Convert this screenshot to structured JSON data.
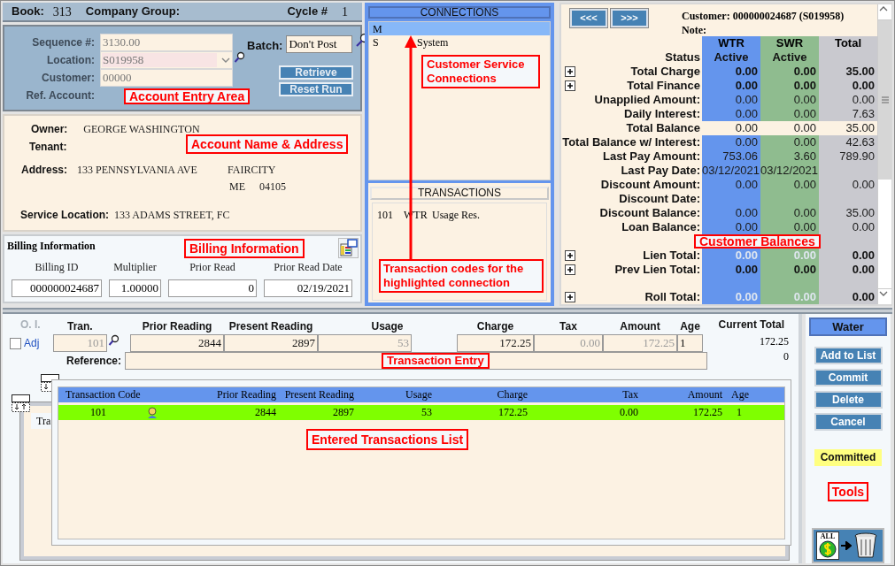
{
  "header": {
    "book_label": "Book:",
    "book": "313",
    "company_group_label": "Company Group:",
    "cycle_label": "Cycle #",
    "cycle": "1"
  },
  "account_entry": {
    "fields": [
      {
        "label": "Sequence #:",
        "value": "3130.00",
        "kind": "text"
      },
      {
        "label": "Location:",
        "value": "S019958",
        "kind": "dropdown"
      },
      {
        "label": "Customer:",
        "value": "00000",
        "kind": "text"
      },
      {
        "label": "Ref. Account:",
        "kind": "none"
      }
    ],
    "batch_label": "Batch:",
    "batch": "Don't Post",
    "buttons": [
      "Retrieve",
      "Reset Run"
    ],
    "annotation": "Account Entry Area"
  },
  "name_address": {
    "owner_label": "Owner:",
    "owner": "GEORGE WASHINGTON",
    "tenant_label": "Tenant:",
    "address_label": "Address:",
    "street": "133 PENNSYLVANIA AVE",
    "city": "FAIRCITY",
    "state": "ME",
    "zip": "04105",
    "service_location_label": "Service Location:",
    "service_location": "133 ADAMS STREET, FC",
    "annotation": "Account Name & Address"
  },
  "billing": {
    "title": "Billing Information",
    "annotation": "Billing Information",
    "fields": [
      {
        "label": "Billing ID",
        "value": "000000024687"
      },
      {
        "label": "Multiplier",
        "value": "1.00000"
      },
      {
        "label": "Prior Read",
        "value": "0"
      },
      {
        "label": "Prior Read Date",
        "value": "02/19/2021"
      }
    ]
  },
  "connections": {
    "title": "CONNECTIONS",
    "items": [
      {
        "code": "M",
        "selected": true
      },
      {
        "code": "S",
        "name": "System",
        "selected": false
      }
    ],
    "annotation": "Customer Service Connections"
  },
  "transactions": {
    "title": "TRANSACTIONS",
    "items": [
      {
        "code": "101",
        "service": "WTR",
        "description": "Usage Res."
      }
    ],
    "annotation": "Transaction codes for the highlighted connection"
  },
  "balances": {
    "nav": [
      "<<<",
      ">>>"
    ],
    "customer": "Customer: 000000024687 (S019958)",
    "note": "Note:",
    "columns": [
      "WTR",
      "SWR",
      "Total"
    ],
    "annotation": "Customer Balances",
    "rows": [
      {
        "label": "Status",
        "wtr": "Active",
        "swr": "Active",
        "kind": "status",
        "expandable": false
      },
      {
        "label": "Total Charge",
        "wtr": "0.00",
        "swr": "0.00",
        "total": "35.00",
        "kind": "bold",
        "expandable": true
      },
      {
        "label": "Total Finance",
        "wtr": "0.00",
        "swr": "0.00",
        "total": "0.00",
        "kind": "bold",
        "expandable": true
      },
      {
        "label": "Unapplied Amount:",
        "wtr": "0.00",
        "swr": "0.00",
        "total": "0.00",
        "kind": "normal",
        "expandable": false
      },
      {
        "label": "Daily Interest:",
        "wtr": "0.00",
        "swr": "0.00",
        "total": "7.63",
        "kind": "normal",
        "expandable": false
      },
      {
        "label": "Total Balance",
        "wtr": "0.00",
        "swr": "0.00",
        "total": "35.00",
        "kind": "highlight",
        "expandable": false
      },
      {
        "label": "Total Balance w/ Interest:",
        "wtr": "0.00",
        "swr": "0.00",
        "total": "42.63",
        "kind": "normal",
        "expandable": false
      },
      {
        "label": "Last Pay Amount:",
        "wtr": "753.06",
        "swr": "3.60",
        "total": "789.90",
        "kind": "normal",
        "expandable": false
      },
      {
        "label": "Last Pay Date:",
        "wtr": "03/12/2021",
        "swr": "03/12/2021",
        "kind": "normal",
        "expandable": false
      },
      {
        "label": "Discount Amount:",
        "wtr": "0.00",
        "swr": "0.00",
        "total": "0.00",
        "kind": "normal",
        "expandable": false
      },
      {
        "label": "Discount Date:",
        "kind": "normal",
        "expandable": false
      },
      {
        "label": "Discount Balance:",
        "wtr": "0.00",
        "swr": "0.00",
        "total": "35.00",
        "kind": "normal",
        "expandable": false
      },
      {
        "label": "Loan Balance:",
        "wtr": "0.00",
        "swr": "0.00",
        "total": "0.00",
        "kind": "normal",
        "expandable": false
      },
      {
        "label": "Lien Total:",
        "wtr": "0.00",
        "swr": "0.00",
        "total": "0.00",
        "kind": "dimmed",
        "expandable": true,
        "gap_before": true
      },
      {
        "label": "Prev Lien Total:",
        "wtr": "0.00",
        "swr": "0.00",
        "total": "0.00",
        "kind": "bold",
        "expandable": true
      },
      {
        "label": "Roll Total:",
        "wtr": "0.00",
        "swr": "0.00",
        "total": "0.00",
        "kind": "dimmed",
        "expandable": true,
        "gap_before": true
      }
    ]
  },
  "entry": {
    "oi_label": "O. I.",
    "adj": {
      "label": "Adj",
      "checked": false
    },
    "fields": [
      {
        "label": "Tran.",
        "value": "101",
        "disabled": true
      },
      {
        "label": "Prior Reading",
        "value": "2844",
        "disabled": false
      },
      {
        "label": "Present Reading",
        "value": "2897",
        "disabled": false
      },
      {
        "label": "Usage",
        "value": "53",
        "disabled": true
      },
      {
        "label": "Charge",
        "value": "172.25",
        "disabled": false
      },
      {
        "label": "Tax",
        "value": "0.00",
        "disabled": true
      },
      {
        "label": "Amount",
        "value": "172.25",
        "disabled": true
      },
      {
        "label": "Age",
        "value": "1",
        "disabled": false
      }
    ],
    "reference_label": "Reference:",
    "current_total_label": "Current Total",
    "current_total": "172.25",
    "current_total_2": "0",
    "annotation": "Transaction Entry"
  },
  "entered_list": {
    "back_tab": "Tra",
    "columns": [
      "Transaction Code",
      "Prior Reading",
      "Present Reading",
      "Usage",
      "Charge",
      "Tax",
      "Amount",
      "Age"
    ],
    "rows": [
      {
        "cells": [
          "101",
          "2844",
          "2897",
          "53",
          "172.25",
          "0.00",
          "172.25",
          "1"
        ],
        "selected": true
      }
    ],
    "annotation": "Entered Transactions List"
  },
  "tools": {
    "title": "Water",
    "buttons": [
      "Add to List",
      "Commit",
      "Delete",
      "Cancel"
    ],
    "status": "Committed",
    "annotation": "Tools",
    "all_label": "ALL"
  }
}
